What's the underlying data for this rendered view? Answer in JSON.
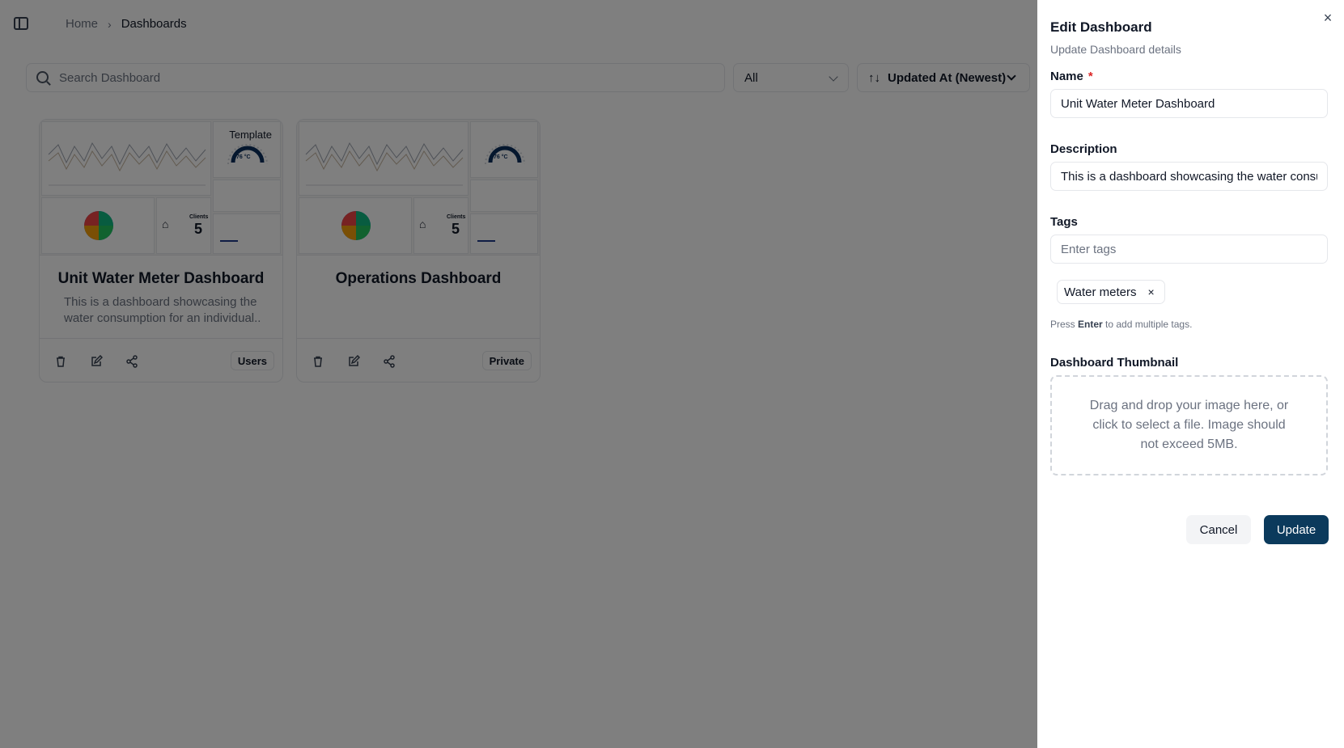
{
  "breadcrumb": {
    "home": "Home",
    "separator": "›",
    "current": "Dashboards"
  },
  "toolbar": {
    "search_placeholder": "Search Dashboard",
    "filter_value": "All",
    "sort_icon": "↑↓",
    "sort_value": "Updated At (Newest)"
  },
  "cards": [
    {
      "title": "Unit Water Meter Dashboard",
      "description": "This is a dashboard showcasing the water consumption for an individual..",
      "thumb_label": "Template",
      "thumb_gauge": "76 °C",
      "thumb_clients_label": "Clients",
      "thumb_clients_value": "5",
      "badge": "Users"
    },
    {
      "title": "Operations Dashboard",
      "description": "",
      "thumb_gauge": "76 °C",
      "thumb_clients_label": "Clients",
      "thumb_clients_value": "5",
      "badge": "Private"
    }
  ],
  "drawer": {
    "close_icon": "×",
    "title": "Edit Dashboard",
    "subtitle": "Update Dashboard details",
    "name_label": "Name",
    "required_mark": "*",
    "name_value": "Unit Water Meter Dashboard",
    "description_label": "Description",
    "description_value": "This is a dashboard showcasing the water consumption for an individual..",
    "tags_label": "Tags",
    "tags_placeholder": "Enter tags",
    "tags": [
      {
        "label": "Water meters",
        "remove_icon": "×"
      }
    ],
    "helper_prefix": "Press ",
    "helper_key": "Enter",
    "helper_suffix": " to add multiple tags.",
    "thumbnail_label": "Dashboard Thumbnail",
    "dropzone_text": "Drag and drop your image here, or click to select a file. Image should not exceed 5MB.",
    "cancel_label": "Cancel",
    "update_label": "Update"
  },
  "colors": {
    "primary": "#0b3a5c",
    "required": "#dc2626",
    "overlay": "rgba(0,0,0,0.5)"
  },
  "icons": [
    "sidebar-toggle-icon",
    "search-icon",
    "chevron-down-icon",
    "sort-icon",
    "trash-icon",
    "edit-icon",
    "share-icon",
    "close-icon"
  ]
}
